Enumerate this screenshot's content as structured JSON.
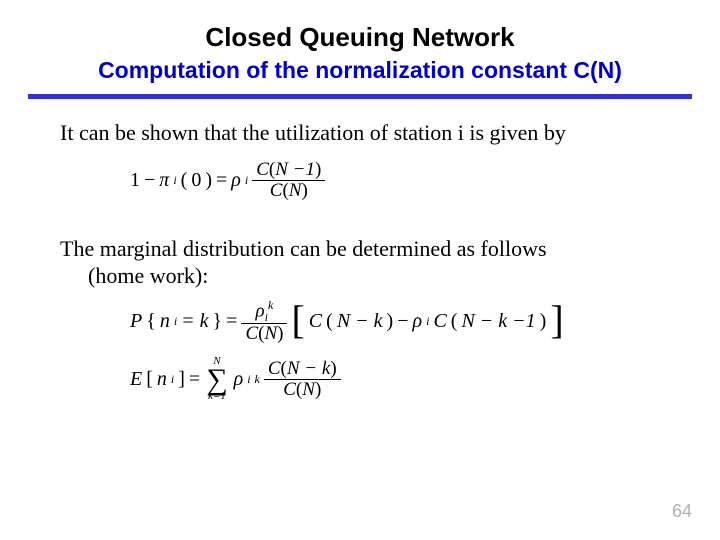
{
  "title": "Closed Queuing Network",
  "subtitle": "Computation of the normalization constant C(N)",
  "para1": "It can be shown that the utilization of station i is given by",
  "para2_line1": "The marginal distribution can be determined as follows",
  "para2_line2": "(home work):",
  "page_number": "64",
  "eq1": {
    "lhs_a": "1",
    "minus": "−",
    "pi": "π",
    "sub_i": "i",
    "lparen": "(",
    "zero": "0",
    "rparen": ")",
    "eq": "=",
    "rho": "ρ",
    "num": "C",
    "num_arg_l": "(",
    "num_arg": "N −1",
    "num_arg_r": ")",
    "den": "C",
    "den_arg_l": "(",
    "den_arg": "N",
    "den_arg_r": ")"
  },
  "eq2": {
    "P": "P",
    "lbrace": "{",
    "n": "n",
    "sub_i": "i",
    "eqk": " = k",
    "rbrace": "}",
    "eq": "=",
    "num_rho": "ρ",
    "num_sup": "k",
    "den": "C",
    "den_arg_l": "(",
    "den_arg": "N",
    "den_arg_r": ")",
    "br_l": "[",
    "C1": "C",
    "a1_l": "(",
    "a1": "N − k",
    "a1_r": ")",
    "minus": "−",
    "rho2": "ρ",
    "C2": "C",
    "a2_l": "(",
    "a2": "N − k −1",
    "a2_r": ")",
    "br_r": "]"
  },
  "eq3": {
    "E": "E",
    "lbr": "[",
    "n": "n",
    "sub_i": "i",
    "rbr": "]",
    "eq": "=",
    "sum_top": "N",
    "sum_bot": "k=1",
    "rho": "ρ",
    "sup": "k",
    "num": "C",
    "num_arg_l": "(",
    "num_arg": "N − k",
    "num_arg_r": ")",
    "den": "C",
    "den_arg_l": "(",
    "den_arg": "N",
    "den_arg_r": ")"
  }
}
